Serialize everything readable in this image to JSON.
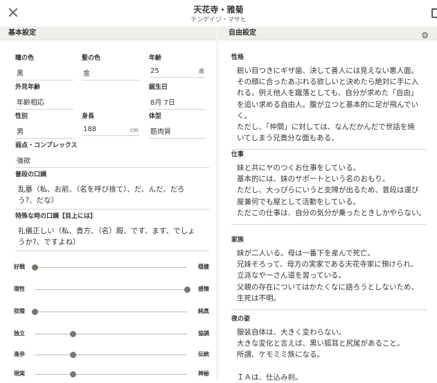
{
  "header": {
    "name": "天花寺・雅菊",
    "reading": "テンゲイジ・マサヒ"
  },
  "sections": {
    "basic": "基本設定",
    "free": "自由設定"
  },
  "fields": {
    "eye_color": {
      "label": "瞳の色",
      "value": "黒"
    },
    "hair_color": {
      "label": "髪の色",
      "value": "金"
    },
    "age": {
      "label": "年齢",
      "value": "25",
      "unit": "歳"
    },
    "apparent_age": {
      "label": "外見年齢",
      "value": "年齢相応"
    },
    "birthday": {
      "label": "誕生日",
      "value": "8月 7日"
    },
    "gender": {
      "label": "性別",
      "value": "男"
    },
    "height": {
      "label": "身長",
      "value": "188",
      "unit": "cm"
    },
    "build": {
      "label": "体型",
      "value": "筋肉質"
    },
    "weakness": {
      "label": "弱点・コンプレックス",
      "value": "強欲"
    },
    "normal_speech": {
      "label": "普段の口調",
      "lines": [
        "乱暴（私、お前、（名を呼び捨て）、だ、んだ、だろ",
        "う?、だな）"
      ]
    },
    "special_speech": {
      "label": "特殊な時の口調【目上には】",
      "lines": [
        "礼儀正しい（私、貴方、（名）殿、です、ます、でしょ",
        "うか?、ですよね）"
      ]
    }
  },
  "sliders": [
    {
      "left": "好戦",
      "right": "穏健",
      "value": 0.0
    },
    {
      "left": "理性",
      "right": "感情",
      "value": 1.0
    },
    {
      "left": "狡猾",
      "right": "純真",
      "value": 0.0
    },
    {
      "left": "独立",
      "right": "協調",
      "value": 0.25
    },
    {
      "left": "進歩",
      "right": "伝統",
      "value": 0.25
    },
    {
      "left": "現実",
      "right": "神秘",
      "value": 0.25
    }
  ],
  "free": {
    "personality": {
      "label": "性格",
      "lines": [
        "鋭い目つきにギザ歯、決して善人には見えない悪人面。",
        "その顔に合ったあぶれる欲しいと決めたら絶対に手に入",
        "れる。例え他人を蹴落としても、自分が求めた「自由」",
        "を追い求める自由人。腹が立つと基本的に足が飛んでい",
        "く。",
        "ただし、「仲間」に対しては、なんだかんだで世話を焼",
        "いてしまう兄貴分な面もある。"
      ]
    },
    "work": {
      "label": "仕事",
      "lines": [
        "妹と共にヤのつくお仕事をしている。",
        "基本的には、妹のサポートという名のおもり。",
        "ただし、大っぴらにいうと支障が出るため、普段は運び",
        "屋兼何でも屋として活動をしている。",
        "ただこの仕事は、自分の気分が乗ったときしかやらない。"
      ]
    },
    "family": {
      "label": "家族",
      "lines": [
        "妹が二人いる。母は一番下を産んで死亡。",
        "兄妹そろって、母方の実家である天花寺家に預けられ、",
        "立派なやーさん道を習っている。",
        "父親の存在についてはかたくなに語ろうとしないため、",
        "生死は不明。"
      ]
    },
    "night": {
      "label": "夜の姿",
      "lines": [
        "服装自体は、大きく変わらない。",
        "大きな変化と言えば、黒い狐耳と尻尾があること。",
        "所謂、ケモミミ族になる。",
        "",
        "ＩＡは、仕込み刹。"
      ]
    }
  }
}
